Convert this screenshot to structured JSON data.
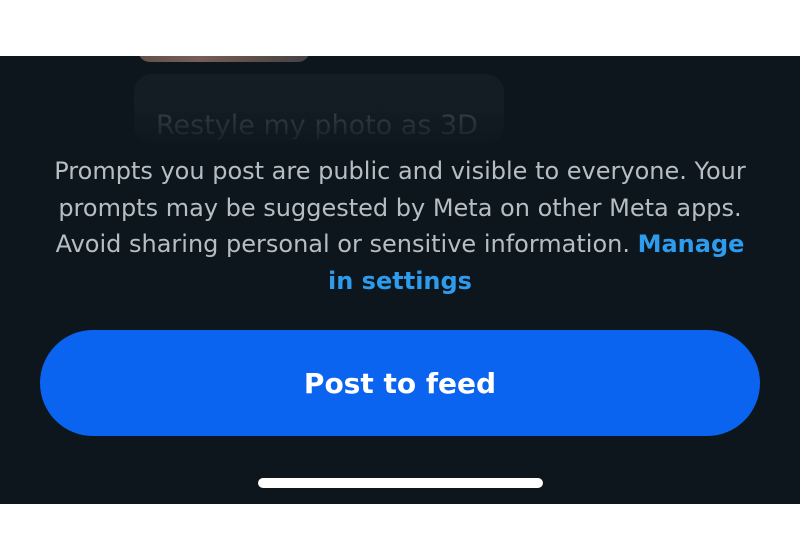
{
  "suggestion": {
    "text": "Restyle my photo as 3D"
  },
  "disclaimer": {
    "body": "Prompts you post are public and visible to everyone. Your prompts may be suggested by Meta on other Meta apps. Avoid sharing personal or sensitive information. ",
    "link_label": "Manage in settings",
    "link_color": "#2e9bec"
  },
  "primary_action": {
    "label": "Post to feed",
    "color": "#0a64ef"
  },
  "colors": {
    "background": "#0c161c",
    "text": "#b7bec3"
  }
}
